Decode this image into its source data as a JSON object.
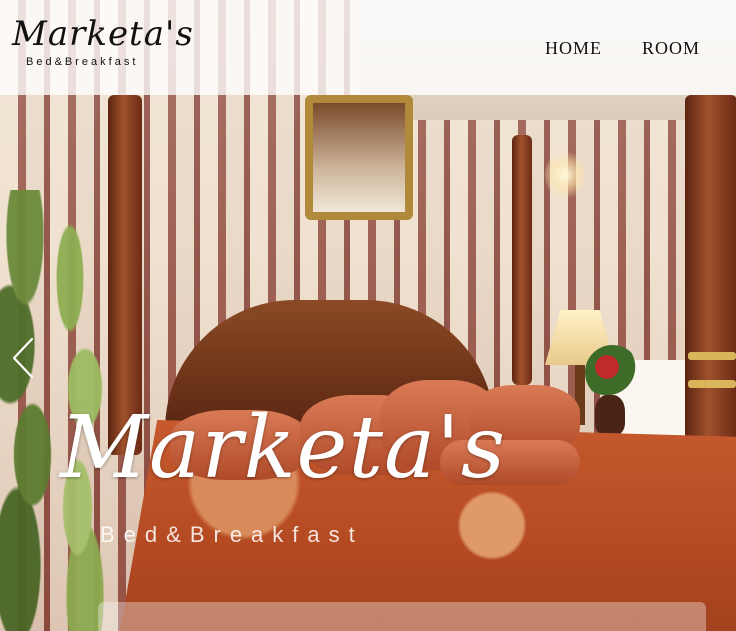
{
  "header": {
    "logo_script": "Marketa's",
    "logo_sub": "Bed&Breakfast",
    "nav": [
      {
        "label": "HOME"
      },
      {
        "label": "ROOM"
      }
    ]
  },
  "hero": {
    "title": "Marketa's",
    "subtitle": "Bed&Breakfast"
  },
  "icons": {
    "prev": "chevron-left-icon"
  },
  "colors": {
    "header_bg": "#ffffff",
    "text_dark": "#111111",
    "hero_text": "#ffffff"
  }
}
